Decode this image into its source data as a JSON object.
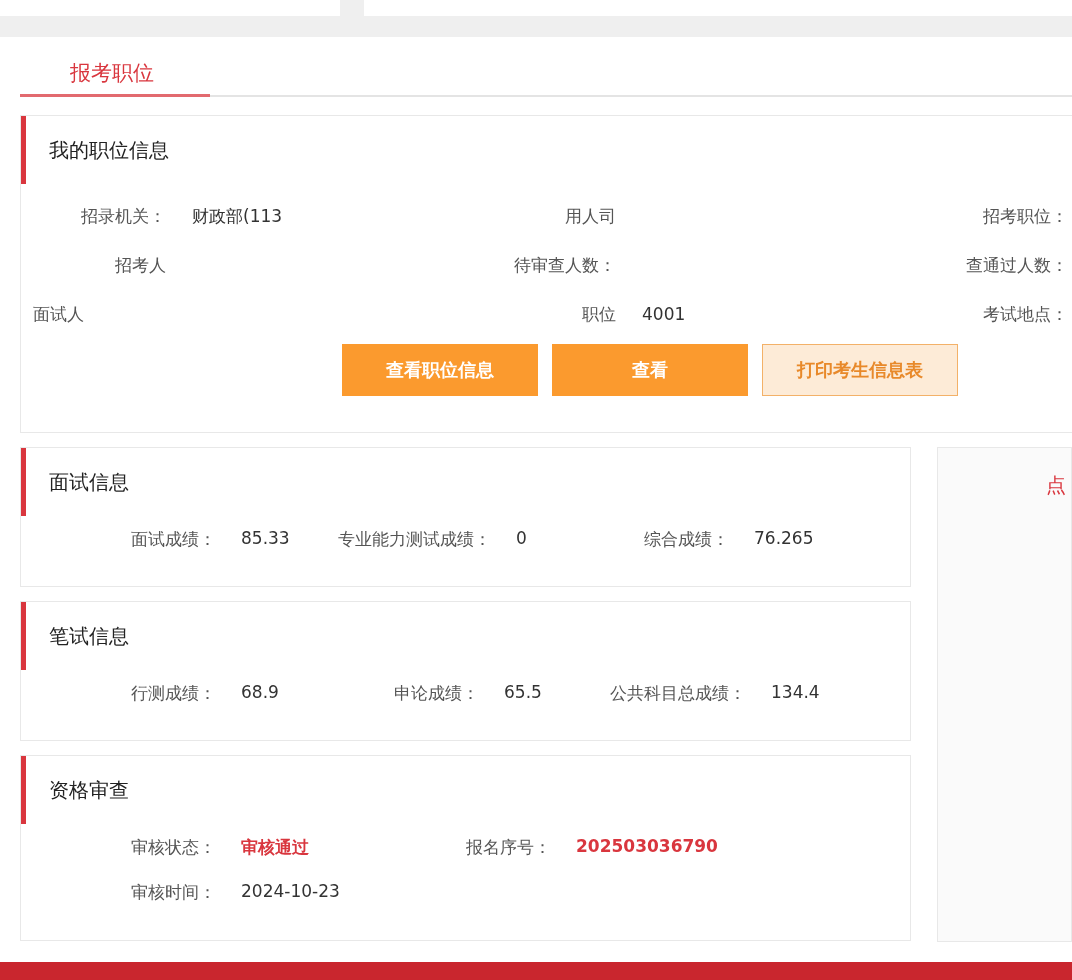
{
  "tabs": [
    {
      "label": "报考职位",
      "selected": true
    }
  ],
  "position_card": {
    "title": "我的职位信息",
    "rows": [
      [
        {
          "label": "招录机关：",
          "value": "财政部(113"
        },
        {
          "label": "用人司"
        },
        {
          "label": "招考职位："
        }
      ],
      [
        {
          "label": "招考人"
        },
        {
          "label": "待审查人数："
        },
        {
          "label": "查通过人数："
        }
      ],
      [
        {
          "label": "面试人"
        },
        {
          "label": "职位",
          "value": "4001"
        },
        {
          "label": "考试地点："
        }
      ]
    ],
    "buttons": [
      {
        "label": "查看职位信息",
        "kind": "solid"
      },
      {
        "label": "查看",
        "kind": "solid"
      },
      {
        "label": "打印考生信息表",
        "kind": "outline"
      }
    ]
  },
  "score_cards": [
    {
      "title": "面试信息",
      "fields": [
        {
          "label": "面试成绩：",
          "value": "85.33",
          "emphasis": false
        },
        {
          "label": "专业能力测试成绩：",
          "value": "0",
          "emphasis": false
        },
        {
          "label": "综合成绩：",
          "value": "76.265",
          "emphasis": false
        }
      ]
    },
    {
      "title": "笔试信息",
      "fields": [
        {
          "label": "行测成绩：",
          "value": "68.9",
          "emphasis": false
        },
        {
          "label": "申论成绩：",
          "value": "65.5",
          "emphasis": false
        },
        {
          "label": "公共科目总成绩：",
          "value": "134.4",
          "emphasis": false
        }
      ]
    },
    {
      "title": "资格审查",
      "fields": [
        {
          "label": "审核状态：",
          "value": "审核通过",
          "emphasis": true
        },
        {
          "label": "报名序号：",
          "value": "202503036790",
          "emphasis": true
        },
        {
          "label": "审核时间：",
          "value": "2024-10-23",
          "emphasis": false
        }
      ]
    }
  ],
  "side_panel": {
    "text": "点"
  }
}
